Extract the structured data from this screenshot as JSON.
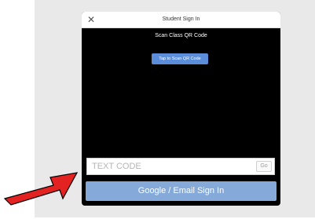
{
  "modal": {
    "title": "Student Sign In",
    "close_icon": "close-icon",
    "scan_label": "Scan Class QR Code",
    "scan_button_label": "Tap to Scan QR Code",
    "code_placeholder": "TEXT CODE",
    "go_label": "Go",
    "google_button_label": "Google / Email Sign In"
  },
  "annotation": {
    "arrow_icon": "red-arrow-icon",
    "arrow_color": "#e32222"
  },
  "colors": {
    "button_blue": "#5b8ddb",
    "google_blue": "#85a9d9"
  }
}
